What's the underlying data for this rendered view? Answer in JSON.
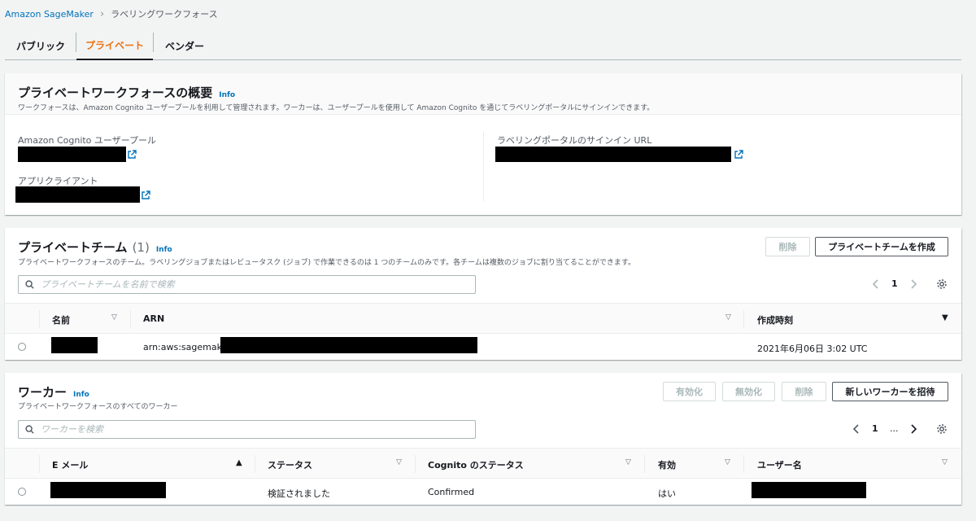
{
  "breadcrumb": {
    "root": "Amazon SageMaker",
    "current": "ラベリングワークフォース"
  },
  "tabs": [
    {
      "label": "パブリック",
      "active": false
    },
    {
      "label": "プライベート",
      "active": true
    },
    {
      "label": "ベンダー",
      "active": false
    }
  ],
  "overview": {
    "title": "プライベートワークフォースの概要",
    "info": "Info",
    "description": "ワークフォースは、Amazon Cognito ユーザープールを利用して管理されます。ワーカーは、ユーザープールを使用して Amazon Cognito を通じてラベリングポータルにサインインできます。",
    "user_pool_label": "Amazon Cognito ユーザープール",
    "app_client_label": "アプリクライアント",
    "signin_url_label": "ラベリングポータルのサインイン URL"
  },
  "teams": {
    "title": "プライベートチーム",
    "count": "(1)",
    "info": "Info",
    "description": "プライベートワークフォースのチーム。ラベリングジョブまたはレビュータスク (ジョブ) で作業できるのは 1 つのチームのみです。各チームは複数のジョブに割り当てることができます。",
    "delete_label": "削除",
    "create_label": "プライベートチームを作成",
    "search_placeholder": "プライベートチームを名前で検索",
    "page": "1",
    "columns": {
      "name": "名前",
      "arn": "ARN",
      "created": "作成時刻"
    },
    "rows": [
      {
        "arn_prefix": "arn:aws:sagemaker:",
        "created": "2021年6月06日 3:02 UTC"
      }
    ]
  },
  "workers": {
    "title": "ワーカー",
    "info": "Info",
    "description": "プライベートワークフォースのすべてのワーカー",
    "enable_label": "有効化",
    "disable_label": "無効化",
    "delete_label": "削除",
    "invite_label": "新しいワーカーを招待",
    "search_placeholder": "ワーカーを検索",
    "page": "1",
    "ellipsis": "...",
    "columns": {
      "email": "E メール",
      "status": "ステータス",
      "cognito_status": "Cognito のステータス",
      "enabled": "有効",
      "username": "ユーザー名"
    },
    "rows": [
      {
        "status": "検証されました",
        "cognito_status": "Confirmed",
        "enabled": "はい"
      }
    ]
  }
}
